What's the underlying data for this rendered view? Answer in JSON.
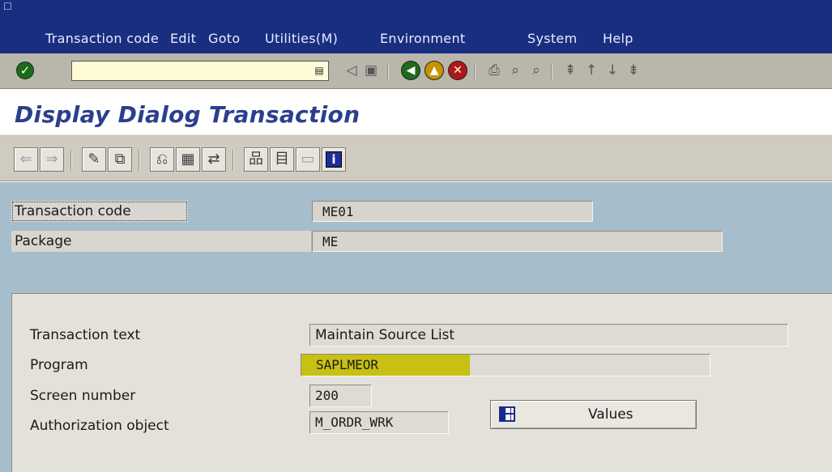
{
  "menubar": {
    "items": [
      "Transaction code",
      "Edit",
      "Goto",
      "Utilities(M)",
      "Environment",
      "System",
      "Help"
    ]
  },
  "toolbar": {
    "command_field_value": ""
  },
  "title": "Display Dialog Transaction",
  "header": {
    "transaction_code": {
      "label": "Transaction code",
      "value": "ME01"
    },
    "package": {
      "label": "Package",
      "value": "ME"
    }
  },
  "details": {
    "transaction_text": {
      "label": "Transaction text",
      "value": "Maintain Source List"
    },
    "program": {
      "label": "Program",
      "value": "SAPLMEOR"
    },
    "screen_number": {
      "label": "Screen number",
      "value": "200"
    },
    "authorization_object": {
      "label": "Authorization object",
      "value": "M_ORDR_WRK"
    },
    "values_button": "Values"
  },
  "colors": {
    "menubar_bg": "#1a2e80",
    "title_text": "#2b3f8c",
    "main_bg": "#a6bdcc",
    "program_highlight": "#c8c012"
  }
}
